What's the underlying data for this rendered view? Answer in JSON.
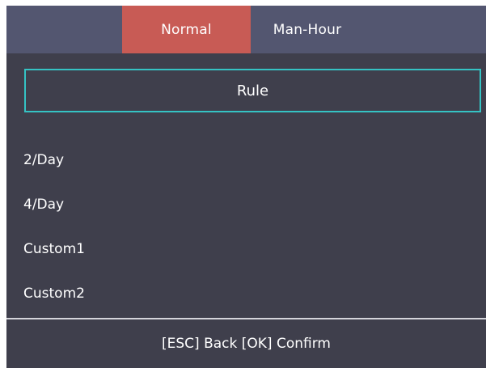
{
  "tabs": [
    {
      "label": "Normal",
      "active": true
    },
    {
      "label": "Man-Hour",
      "active": false
    }
  ],
  "rule": {
    "label": "Rule"
  },
  "options": [
    {
      "label": "2/Day"
    },
    {
      "label": "4/Day"
    },
    {
      "label": "Custom1"
    },
    {
      "label": "Custom2"
    }
  ],
  "footer": {
    "hint": "[ESC] Back [OK] Confirm"
  },
  "colors": {
    "background": "#3f3f4c",
    "tabbar": "#535670",
    "active_tab": "#c85b55",
    "focus_border": "#35c3c4",
    "divider": "#d4d4da",
    "text": "#ffffff"
  }
}
